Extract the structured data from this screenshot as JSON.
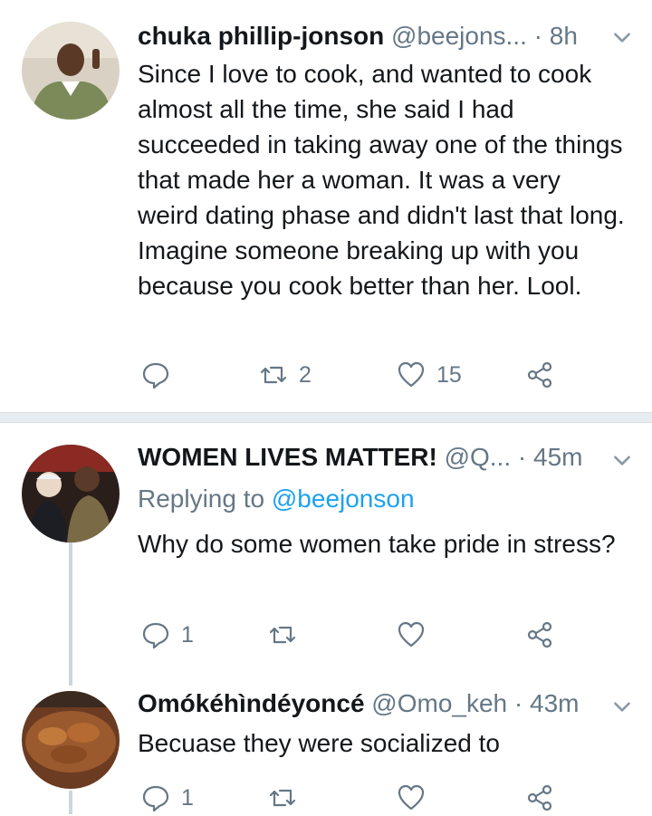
{
  "tweets": [
    {
      "name": "chuka phillip-jonson",
      "handle": "@beejons...",
      "time": "· 8h",
      "text": "Since I love to cook, and wanted to cook almost all the time, she said I had succeeded in taking away one of the things that made her a woman. It was a very weird dating phase and didn't last that long. Imagine someone breaking up with you because you cook better than her. Lool.",
      "reply_count": "",
      "retweet_count": "2",
      "like_count": "15"
    },
    {
      "name": "WOMEN LIVES MATTER!",
      "handle": "@Q...",
      "time": "· 45m",
      "replying_prefix": "Replying to ",
      "replying_to": "@beejonson",
      "text": "Why do some women take pride in stress?",
      "reply_count": "1",
      "retweet_count": "",
      "like_count": ""
    },
    {
      "name": "Omókéhìndéyoncé",
      "handle": "@Omo_keh",
      "time": "· 43m",
      "text": "Becuase they were socialized to",
      "reply_count": "1",
      "retweet_count": "",
      "like_count": ""
    }
  ],
  "icons": {
    "reply": "reply-icon",
    "retweet": "retweet-icon",
    "like": "heart-icon",
    "share": "share-icon",
    "more": "chevron-down-icon"
  },
  "colors": {
    "text": "#14171a",
    "muted": "#657786",
    "link": "#1da1f2",
    "divider": "#e6ecf0"
  }
}
